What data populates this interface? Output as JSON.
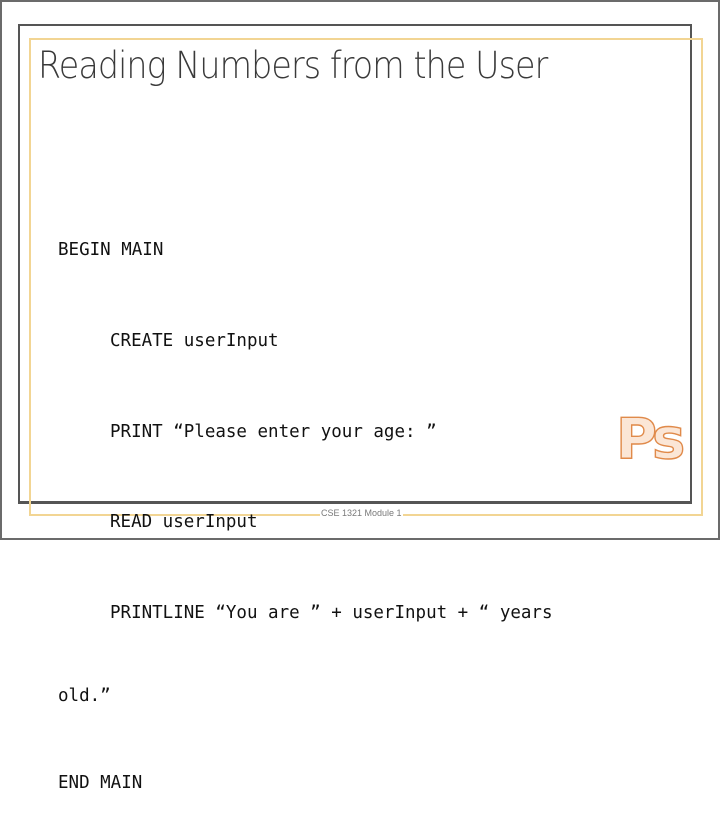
{
  "slide": {
    "title": "Reading Numbers from the User",
    "code_lines": [
      {
        "text": "BEGIN MAIN",
        "indent": false
      },
      {
        "text": "CREATE userInput",
        "indent": true
      },
      {
        "text": "PRINT “Please enter your age: ”",
        "indent": true
      },
      {
        "text": "READ userInput",
        "indent": true
      },
      {
        "text": "PRINTLINE “You are ” + userInput + “ years",
        "indent": true
      },
      {
        "text": "old.”",
        "indent": false,
        "wrap": true
      },
      {
        "text": "END MAIN",
        "indent": false
      }
    ],
    "footer": {
      "center": "CSE 1321 Module 1"
    },
    "logo": {
      "text": "Ps",
      "icon": "photoshop-logo-icon",
      "stroke_color": "#e08a4a",
      "fill_color": "#f7c9a5"
    },
    "colors": {
      "accent_gold": "#f2d593",
      "frame_dark": "#555555"
    }
  }
}
